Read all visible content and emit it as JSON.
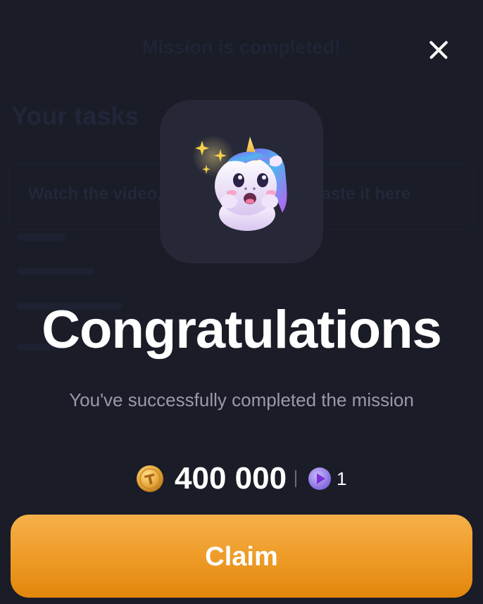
{
  "background_page": {
    "header_title": "Mission is completed!",
    "section_title": "Your tasks",
    "task_text": "Watch the video, find the code and paste it here"
  },
  "modal": {
    "close_icon": "close-icon",
    "hero_icon": "unicorn-sparkles-icon",
    "headline": "Congratulations",
    "subtitle": "You've successfully completed the mission",
    "reward": {
      "coin_icon": "gold-coin-icon",
      "coin_amount": "400 000",
      "ticket_icon": "purple-play-ticket-icon",
      "ticket_count": "1"
    },
    "claim_label": "Claim"
  },
  "colors": {
    "background": "#1a1c27",
    "tile": "#262837",
    "subtitle": "#9a9aad",
    "claim_top": "#f6b04a",
    "claim_bottom": "#e2860c"
  }
}
